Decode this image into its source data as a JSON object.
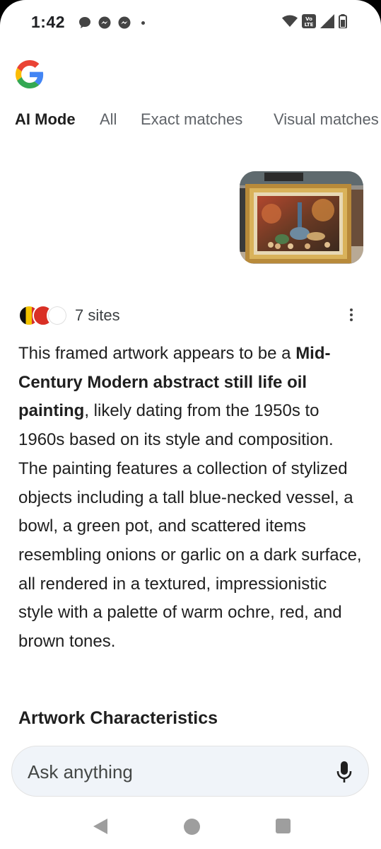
{
  "status_bar": {
    "time": "1:42",
    "left_icons": [
      "chat-bubble-icon",
      "messenger-icon",
      "messenger-icon",
      "dot-icon"
    ],
    "right_icons": [
      "wifi-icon",
      "volte-icon",
      "signal-icon",
      "battery-icon"
    ],
    "volte_label": "Vo LTE"
  },
  "header": {
    "logo": "google-g-logo"
  },
  "tabs": [
    {
      "label": "AI Mode",
      "active": true
    },
    {
      "label": "All"
    },
    {
      "label": "Exact matches"
    },
    {
      "label": "Visual matches"
    }
  ],
  "query_image": {
    "description": "framed still life painting"
  },
  "sources": {
    "label": "7 sites"
  },
  "answer": {
    "intro": "This framed artwork appears to be a ",
    "bold": "Mid-Century Modern abstract still life oil painting",
    "rest": ", likely dating from the 1950s to 1960s based on its style and composition. The painting features a collection of stylized objects including a tall blue-necked vessel, a bowl, a green pot, and scattered items resembling onions or garlic on a dark surface, all rendered in a textured, impressionistic style with a palette of warm ochre, red, and brown tones."
  },
  "section_heading": "Artwork Characteristics",
  "search": {
    "placeholder": "Ask anything"
  },
  "colors": {
    "google_blue": "#4285F4",
    "google_red": "#EA4335",
    "google_yellow": "#FBBC05",
    "google_green": "#34A853",
    "input_bg": "#f0f4f9"
  }
}
